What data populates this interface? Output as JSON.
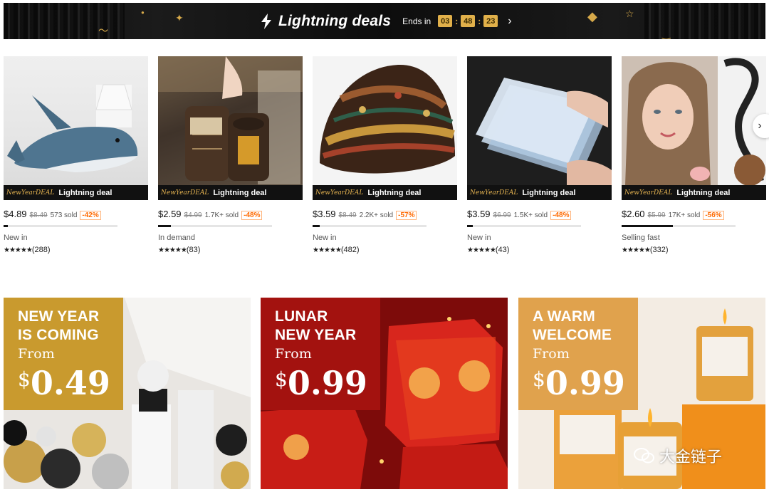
{
  "banner": {
    "title": "Lightning deals",
    "ends_label": "Ends in",
    "hours": "03",
    "minutes": "48",
    "seconds": "23",
    "sep": ":",
    "chevron": "›"
  },
  "deal_tag": {
    "new_year": "NewYearDEAL",
    "lightning": "Lightning deal"
  },
  "products": [
    {
      "price": "$4.89",
      "original": "$8.49",
      "sold": "573 sold",
      "discount": "-42%",
      "status": "New in",
      "stars": "★★★★★",
      "reviews": "(288)",
      "progress": 0.04
    },
    {
      "price": "$2.59",
      "original": "$4.99",
      "sold": "1.7K+ sold",
      "discount": "-48%",
      "status": "In demand",
      "stars": "★★★★★",
      "reviews": "(83)",
      "progress": 0.11
    },
    {
      "price": "$3.59",
      "original": "$8.49",
      "sold": "2.2K+ sold",
      "discount": "-57%",
      "status": "New in",
      "stars": "★★★★★",
      "reviews": "(482)",
      "progress": 0.06
    },
    {
      "price": "$3.59",
      "original": "$6.99",
      "sold": "1.5K+ sold",
      "discount": "-48%",
      "status": "New in",
      "stars": "★★★★★",
      "reviews": "(43)",
      "progress": 0.05
    },
    {
      "price": "$2.60",
      "original": "$5.99",
      "sold": "17K+ sold",
      "discount": "-56%",
      "status": "Selling fast",
      "stars": "★★★★★",
      "reviews": "(332)",
      "progress": 0.45
    }
  ],
  "next_button": "›",
  "promos": [
    {
      "line1": "NEW YEAR",
      "line2": "IS COMING",
      "from": "From",
      "currency": "$",
      "amount": "0.49",
      "panel_color": "#c99a2e"
    },
    {
      "line1": "LUNAR",
      "line2": "NEW YEAR",
      "from": "From",
      "currency": "$",
      "amount": "0.99",
      "panel_color": "#a3120f"
    },
    {
      "line1": "A WARM",
      "line2": "WELCOME",
      "from": "From",
      "currency": "$",
      "amount": "0.99",
      "panel_color": "#e0a24d"
    }
  ],
  "watermark": {
    "text": "大金链子"
  },
  "colors": {
    "accent": "#ff6a00",
    "gold": "#e1b04a"
  }
}
